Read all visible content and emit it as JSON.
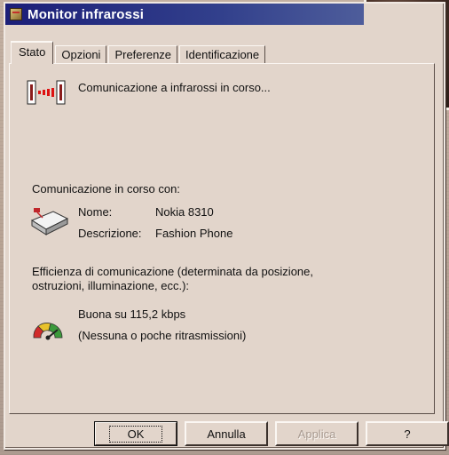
{
  "window": {
    "title": "Monitor infrarossi"
  },
  "tabs": [
    {
      "label": "Stato",
      "active": true
    },
    {
      "label": "Opzioni",
      "active": false
    },
    {
      "label": "Preferenze",
      "active": false
    },
    {
      "label": "Identificazione",
      "active": false
    }
  ],
  "status": {
    "message": "Comunicazione a infrarossi in corso...",
    "icon": "infrared-transfer-icon"
  },
  "connection": {
    "header": "Comunicazione in corso con:",
    "icon": "device-icon",
    "name_label": "Nome:",
    "name_value": "Nokia 8310",
    "desc_label": "Descrizione:",
    "desc_value": "Fashion Phone"
  },
  "efficiency": {
    "header": "Efficienza di comunicazione (determinata da posizione, ostruzioni, illuminazione, ecc.):",
    "icon": "signal-gauge-icon",
    "speed": "Buona su 115,2 kbps",
    "retransmissions": "(Nessuna o poche ritrasmissioni)"
  },
  "buttons": {
    "ok": "OK",
    "cancel": "Annulla",
    "apply": "Applica",
    "help": "?"
  },
  "colors": {
    "titlebar": "#1c1f78",
    "dialog_face": "#e2d5cb"
  }
}
